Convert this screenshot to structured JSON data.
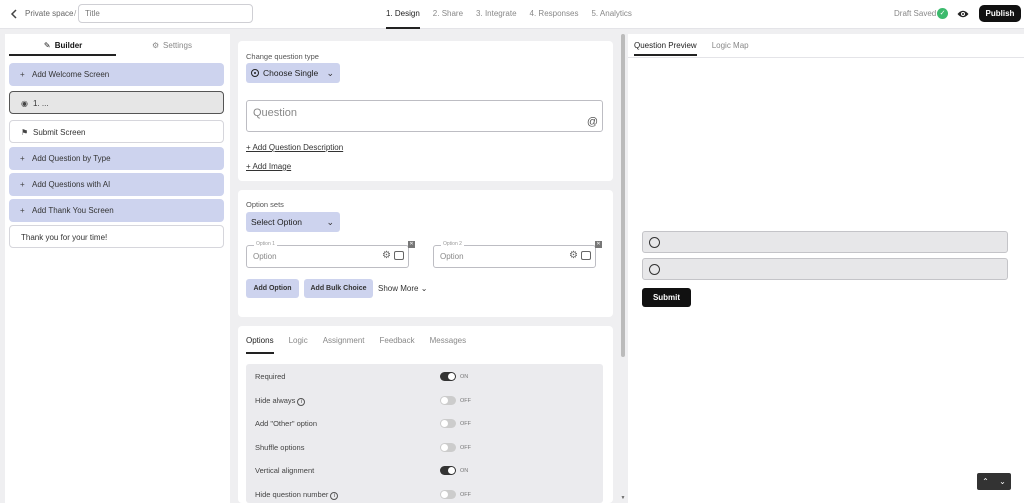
{
  "topbar": {
    "breadcrumb": "Private space",
    "separator": "/",
    "title_placeholder": "Title",
    "steps": [
      "1. Design",
      "2. Share",
      "3. Integrate",
      "4. Responses",
      "5. Analytics"
    ],
    "active_step": 0,
    "draft_status": "Draft Saved",
    "publish_label": "Publish"
  },
  "left": {
    "tabs": {
      "builder": "Builder",
      "settings": "Settings"
    },
    "items": [
      {
        "prefix": "+",
        "label": "Add Welcome Screen"
      },
      {
        "prefix": "◉",
        "label": "1. ..."
      },
      {
        "prefix": "⚑",
        "label": "Submit Screen"
      },
      {
        "prefix": "+",
        "label": "Add Question by Type"
      },
      {
        "prefix": "+",
        "label": "Add Questions with AI"
      },
      {
        "prefix": "+",
        "label": "Add Thank You Screen"
      },
      {
        "prefix": "",
        "label": "Thank you for your time!"
      }
    ]
  },
  "question_card": {
    "change_type_label": "Change question type",
    "type_value": "Choose Single",
    "question_placeholder": "Question",
    "add_description": "+ Add Question Description",
    "add_image": "+ Add Image"
  },
  "options_card": {
    "label": "Option sets",
    "select_value": "Select Option",
    "options": [
      {
        "float_label": "Option 1",
        "value": "Option"
      },
      {
        "float_label": "Option 2",
        "value": "Option"
      }
    ],
    "add_option": "Add Option",
    "add_bulk": "Add Bulk Choice",
    "show_more": "Show More"
  },
  "settings_card": {
    "tabs": [
      "Options",
      "Logic",
      "Assignment",
      "Feedback",
      "Messages"
    ],
    "active_tab": 0,
    "rows": [
      {
        "label": "Required",
        "state": "ON",
        "info": false
      },
      {
        "label": "Hide always",
        "state": "OFF",
        "info": true
      },
      {
        "label": "Add \"Other\" option",
        "state": "OFF",
        "info": false
      },
      {
        "label": "Shuffle options",
        "state": "OFF",
        "info": false
      },
      {
        "label": "Vertical alignment",
        "state": "ON",
        "info": false
      },
      {
        "label": "Hide question number",
        "state": "OFF",
        "info": true
      }
    ]
  },
  "preview": {
    "tabs": [
      "Question Preview",
      "Logic Map"
    ],
    "active_tab": 0,
    "submit_label": "Submit"
  }
}
